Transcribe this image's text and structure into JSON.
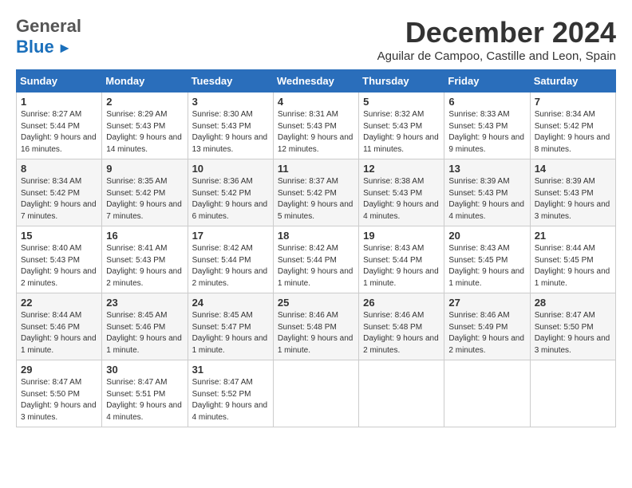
{
  "header": {
    "logo_general": "General",
    "logo_blue": "Blue",
    "month_title": "December 2024",
    "location": "Aguilar de Campoo, Castille and Leon, Spain"
  },
  "calendar": {
    "days_of_week": [
      "Sunday",
      "Monday",
      "Tuesday",
      "Wednesday",
      "Thursday",
      "Friday",
      "Saturday"
    ],
    "weeks": [
      [
        {
          "day": "1",
          "sunrise": "Sunrise: 8:27 AM",
          "sunset": "Sunset: 5:44 PM",
          "daylight": "Daylight: 9 hours and 16 minutes."
        },
        {
          "day": "2",
          "sunrise": "Sunrise: 8:29 AM",
          "sunset": "Sunset: 5:43 PM",
          "daylight": "Daylight: 9 hours and 14 minutes."
        },
        {
          "day": "3",
          "sunrise": "Sunrise: 8:30 AM",
          "sunset": "Sunset: 5:43 PM",
          "daylight": "Daylight: 9 hours and 13 minutes."
        },
        {
          "day": "4",
          "sunrise": "Sunrise: 8:31 AM",
          "sunset": "Sunset: 5:43 PM",
          "daylight": "Daylight: 9 hours and 12 minutes."
        },
        {
          "day": "5",
          "sunrise": "Sunrise: 8:32 AM",
          "sunset": "Sunset: 5:43 PM",
          "daylight": "Daylight: 9 hours and 11 minutes."
        },
        {
          "day": "6",
          "sunrise": "Sunrise: 8:33 AM",
          "sunset": "Sunset: 5:43 PM",
          "daylight": "Daylight: 9 hours and 9 minutes."
        },
        {
          "day": "7",
          "sunrise": "Sunrise: 8:34 AM",
          "sunset": "Sunset: 5:42 PM",
          "daylight": "Daylight: 9 hours and 8 minutes."
        }
      ],
      [
        {
          "day": "8",
          "sunrise": "Sunrise: 8:34 AM",
          "sunset": "Sunset: 5:42 PM",
          "daylight": "Daylight: 9 hours and 7 minutes."
        },
        {
          "day": "9",
          "sunrise": "Sunrise: 8:35 AM",
          "sunset": "Sunset: 5:42 PM",
          "daylight": "Daylight: 9 hours and 7 minutes."
        },
        {
          "day": "10",
          "sunrise": "Sunrise: 8:36 AM",
          "sunset": "Sunset: 5:42 PM",
          "daylight": "Daylight: 9 hours and 6 minutes."
        },
        {
          "day": "11",
          "sunrise": "Sunrise: 8:37 AM",
          "sunset": "Sunset: 5:42 PM",
          "daylight": "Daylight: 9 hours and 5 minutes."
        },
        {
          "day": "12",
          "sunrise": "Sunrise: 8:38 AM",
          "sunset": "Sunset: 5:43 PM",
          "daylight": "Daylight: 9 hours and 4 minutes."
        },
        {
          "day": "13",
          "sunrise": "Sunrise: 8:39 AM",
          "sunset": "Sunset: 5:43 PM",
          "daylight": "Daylight: 9 hours and 4 minutes."
        },
        {
          "day": "14",
          "sunrise": "Sunrise: 8:39 AM",
          "sunset": "Sunset: 5:43 PM",
          "daylight": "Daylight: 9 hours and 3 minutes."
        }
      ],
      [
        {
          "day": "15",
          "sunrise": "Sunrise: 8:40 AM",
          "sunset": "Sunset: 5:43 PM",
          "daylight": "Daylight: 9 hours and 2 minutes."
        },
        {
          "day": "16",
          "sunrise": "Sunrise: 8:41 AM",
          "sunset": "Sunset: 5:43 PM",
          "daylight": "Daylight: 9 hours and 2 minutes."
        },
        {
          "day": "17",
          "sunrise": "Sunrise: 8:42 AM",
          "sunset": "Sunset: 5:44 PM",
          "daylight": "Daylight: 9 hours and 2 minutes."
        },
        {
          "day": "18",
          "sunrise": "Sunrise: 8:42 AM",
          "sunset": "Sunset: 5:44 PM",
          "daylight": "Daylight: 9 hours and 1 minute."
        },
        {
          "day": "19",
          "sunrise": "Sunrise: 8:43 AM",
          "sunset": "Sunset: 5:44 PM",
          "daylight": "Daylight: 9 hours and 1 minute."
        },
        {
          "day": "20",
          "sunrise": "Sunrise: 8:43 AM",
          "sunset": "Sunset: 5:45 PM",
          "daylight": "Daylight: 9 hours and 1 minute."
        },
        {
          "day": "21",
          "sunrise": "Sunrise: 8:44 AM",
          "sunset": "Sunset: 5:45 PM",
          "daylight": "Daylight: 9 hours and 1 minute."
        }
      ],
      [
        {
          "day": "22",
          "sunrise": "Sunrise: 8:44 AM",
          "sunset": "Sunset: 5:46 PM",
          "daylight": "Daylight: 9 hours and 1 minute."
        },
        {
          "day": "23",
          "sunrise": "Sunrise: 8:45 AM",
          "sunset": "Sunset: 5:46 PM",
          "daylight": "Daylight: 9 hours and 1 minute."
        },
        {
          "day": "24",
          "sunrise": "Sunrise: 8:45 AM",
          "sunset": "Sunset: 5:47 PM",
          "daylight": "Daylight: 9 hours and 1 minute."
        },
        {
          "day": "25",
          "sunrise": "Sunrise: 8:46 AM",
          "sunset": "Sunset: 5:48 PM",
          "daylight": "Daylight: 9 hours and 1 minute."
        },
        {
          "day": "26",
          "sunrise": "Sunrise: 8:46 AM",
          "sunset": "Sunset: 5:48 PM",
          "daylight": "Daylight: 9 hours and 2 minutes."
        },
        {
          "day": "27",
          "sunrise": "Sunrise: 8:46 AM",
          "sunset": "Sunset: 5:49 PM",
          "daylight": "Daylight: 9 hours and 2 minutes."
        },
        {
          "day": "28",
          "sunrise": "Sunrise: 8:47 AM",
          "sunset": "Sunset: 5:50 PM",
          "daylight": "Daylight: 9 hours and 3 minutes."
        }
      ],
      [
        {
          "day": "29",
          "sunrise": "Sunrise: 8:47 AM",
          "sunset": "Sunset: 5:50 PM",
          "daylight": "Daylight: 9 hours and 3 minutes."
        },
        {
          "day": "30",
          "sunrise": "Sunrise: 8:47 AM",
          "sunset": "Sunset: 5:51 PM",
          "daylight": "Daylight: 9 hours and 4 minutes."
        },
        {
          "day": "31",
          "sunrise": "Sunrise: 8:47 AM",
          "sunset": "Sunset: 5:52 PM",
          "daylight": "Daylight: 9 hours and 4 minutes."
        },
        null,
        null,
        null,
        null
      ]
    ]
  }
}
